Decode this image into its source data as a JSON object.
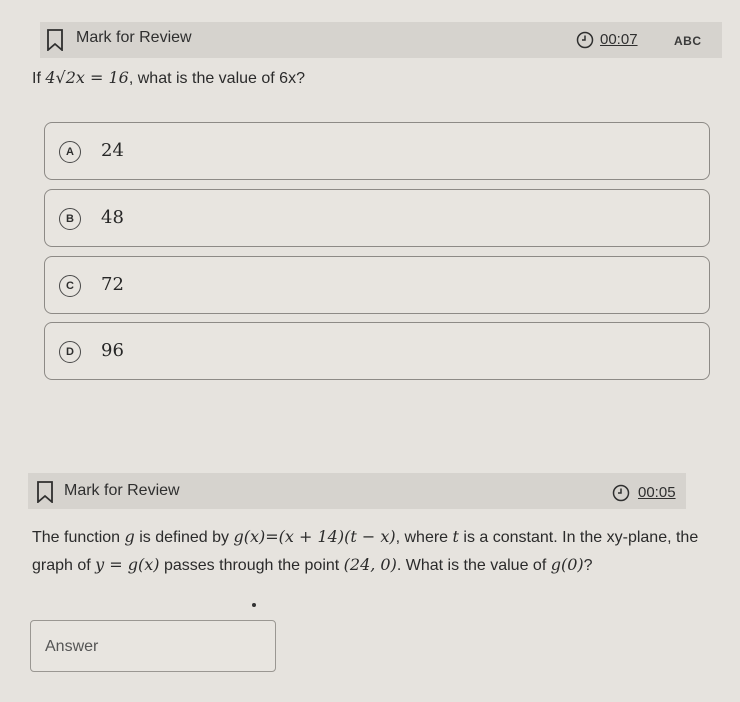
{
  "q1": {
    "mark_label": "Mark for Review",
    "timer": "00:07",
    "abc_label": "ABC",
    "question": {
      "prefix": "If",
      "equation": "4√2x = 16",
      "suffix": ", what is the value of 6x?"
    },
    "options": [
      {
        "letter": "A",
        "value": "24"
      },
      {
        "letter": "B",
        "value": "48"
      },
      {
        "letter": "C",
        "value": "72"
      },
      {
        "letter": "D",
        "value": "96"
      }
    ]
  },
  "q2": {
    "mark_label": "Mark for Review",
    "timer": "00:05",
    "question": {
      "t1": "The function ",
      "g": "g",
      "t2": " is defined by ",
      "def": "g(x)=(x + 14)(t − x)",
      "t3": ", where ",
      "t": "t",
      "t4": " is a constant. In the xy-plane, the graph of ",
      "eq": "y = g(x)",
      "t5": " passes through the point ",
      "pt": "(24, 0)",
      "t6": ". What is the value of ",
      "g0": "g(0)",
      "t7": "?"
    },
    "answer_placeholder": "Answer"
  }
}
